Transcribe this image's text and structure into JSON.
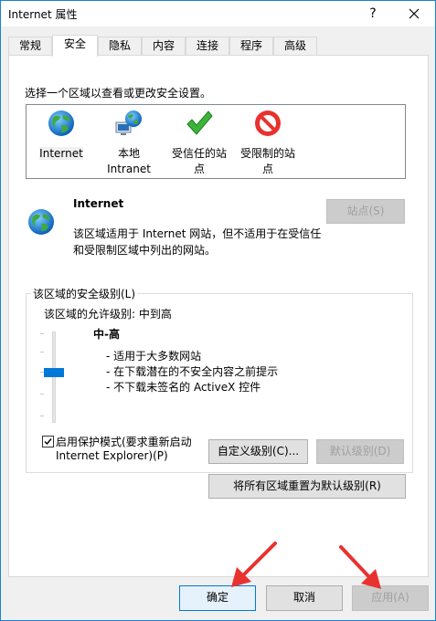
{
  "window": {
    "title": "Internet 属性",
    "help_glyph": "?",
    "close_glyph": "✕"
  },
  "tabs": [
    {
      "label": "常规"
    },
    {
      "label": "安全"
    },
    {
      "label": "隐私"
    },
    {
      "label": "内容"
    },
    {
      "label": "连接"
    },
    {
      "label": "程序"
    },
    {
      "label": "高级"
    }
  ],
  "security": {
    "instruction": "选择一个区域以查看或更改安全设置。",
    "zones": [
      {
        "label_line1": "Internet",
        "label_line2": "",
        "icon": "globe-icon"
      },
      {
        "label_line1": "本地",
        "label_line2": "Intranet",
        "icon": "local-intranet-icon"
      },
      {
        "label_line1": "受信任的站",
        "label_line2": "点",
        "icon": "checkmark-icon"
      },
      {
        "label_line1": "受限制的站",
        "label_line2": "点",
        "icon": "restricted-icon"
      }
    ],
    "selected_zone": {
      "name": "Internet",
      "desc_line1": "该区域适用于 Internet 网站，但不适用于在受信任",
      "desc_line2": "和受限制区域中列出的网站。"
    },
    "sites_button": "站点(S)",
    "level_group_title": "该区域的安全级别(L)",
    "allowed_levels": "该区域的允许级别: 中到高",
    "level_name": "中-高",
    "level_bullets": [
      "- 适用于大多数网站",
      "- 在下载潜在的不安全内容之前提示",
      "- 不下载未签名的 ActiveX 控件"
    ],
    "protected_mode_line1": "启用保护模式(要求重新启动",
    "protected_mode_line2": "Internet Explorer)(P)",
    "protected_mode_checked": true,
    "custom_level_button": "自定义级别(C)...",
    "default_level_button": "默认级别(D)",
    "reset_all_button": "将所有区域重置为默认级别(R)"
  },
  "footer": {
    "ok": "确定",
    "cancel": "取消",
    "apply": "应用(A)"
  },
  "colors": {
    "accent": "#0078d7",
    "annotation_arrow": "#e8322f"
  }
}
